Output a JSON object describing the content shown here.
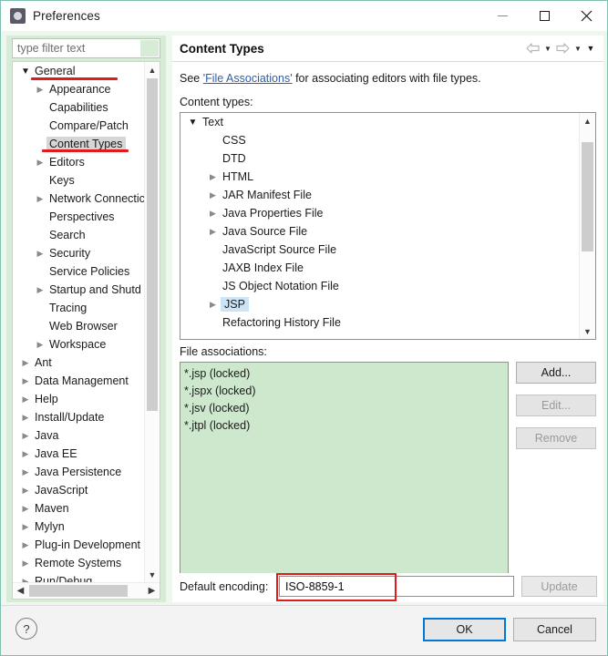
{
  "window": {
    "title": "Preferences",
    "icon": "preferences-gear-icon",
    "controls": {
      "minimize": "—",
      "maximize": "□",
      "close": "✕"
    }
  },
  "filter": {
    "placeholder": "type filter text",
    "value": ""
  },
  "sidebar": {
    "items": [
      {
        "label": "General",
        "indent": 0,
        "arrow": "down",
        "selected": false
      },
      {
        "label": "Appearance",
        "indent": 1,
        "arrow": "right",
        "selected": false
      },
      {
        "label": "Capabilities",
        "indent": 1,
        "arrow": "none",
        "selected": false
      },
      {
        "label": "Compare/Patch",
        "indent": 1,
        "arrow": "none",
        "selected": false
      },
      {
        "label": "Content Types",
        "indent": 1,
        "arrow": "none",
        "selected": true
      },
      {
        "label": "Editors",
        "indent": 1,
        "arrow": "right",
        "selected": false
      },
      {
        "label": "Keys",
        "indent": 1,
        "arrow": "none",
        "selected": false
      },
      {
        "label": "Network Connectic",
        "indent": 1,
        "arrow": "right",
        "selected": false
      },
      {
        "label": "Perspectives",
        "indent": 1,
        "arrow": "none",
        "selected": false
      },
      {
        "label": "Search",
        "indent": 1,
        "arrow": "none",
        "selected": false
      },
      {
        "label": "Security",
        "indent": 1,
        "arrow": "right",
        "selected": false
      },
      {
        "label": "Service Policies",
        "indent": 1,
        "arrow": "none",
        "selected": false
      },
      {
        "label": "Startup and Shutd",
        "indent": 1,
        "arrow": "right",
        "selected": false
      },
      {
        "label": "Tracing",
        "indent": 1,
        "arrow": "none",
        "selected": false
      },
      {
        "label": "Web Browser",
        "indent": 1,
        "arrow": "none",
        "selected": false
      },
      {
        "label": "Workspace",
        "indent": 1,
        "arrow": "right",
        "selected": false
      },
      {
        "label": "Ant",
        "indent": 0,
        "arrow": "right",
        "selected": false
      },
      {
        "label": "Data Management",
        "indent": 0,
        "arrow": "right",
        "selected": false
      },
      {
        "label": "Help",
        "indent": 0,
        "arrow": "right",
        "selected": false
      },
      {
        "label": "Install/Update",
        "indent": 0,
        "arrow": "right",
        "selected": false
      },
      {
        "label": "Java",
        "indent": 0,
        "arrow": "right",
        "selected": false
      },
      {
        "label": "Java EE",
        "indent": 0,
        "arrow": "right",
        "selected": false
      },
      {
        "label": "Java Persistence",
        "indent": 0,
        "arrow": "right",
        "selected": false
      },
      {
        "label": "JavaScript",
        "indent": 0,
        "arrow": "right",
        "selected": false
      },
      {
        "label": "Maven",
        "indent": 0,
        "arrow": "right",
        "selected": false
      },
      {
        "label": "Mylyn",
        "indent": 0,
        "arrow": "right",
        "selected": false
      },
      {
        "label": "Plug-in Development",
        "indent": 0,
        "arrow": "right",
        "selected": false
      },
      {
        "label": "Remote Systems",
        "indent": 0,
        "arrow": "right",
        "selected": false
      },
      {
        "label": "Run/Debug",
        "indent": 0,
        "arrow": "right",
        "selected": false
      }
    ]
  },
  "page": {
    "title": "Content Types",
    "toolbar": {
      "back_icon": "back-arrow-icon",
      "back_menu_icon": "chevron-down-icon",
      "forward_icon": "forward-arrow-icon",
      "forward_menu_icon": "chevron-down-icon",
      "menu_icon": "chevron-down-icon"
    },
    "description_prefix": "See ",
    "description_link": "'File Associations'",
    "description_suffix": " for associating editors with file types.",
    "content_types_label": "Content types:",
    "content_types": [
      {
        "label": "Text",
        "indent": 0,
        "arrow": "down",
        "selected": false
      },
      {
        "label": "CSS",
        "indent": 1,
        "arrow": "none",
        "selected": false
      },
      {
        "label": "DTD",
        "indent": 1,
        "arrow": "none",
        "selected": false
      },
      {
        "label": "HTML",
        "indent": 1,
        "arrow": "right",
        "selected": false
      },
      {
        "label": "JAR Manifest File",
        "indent": 1,
        "arrow": "right",
        "selected": false
      },
      {
        "label": "Java Properties File",
        "indent": 1,
        "arrow": "right",
        "selected": false
      },
      {
        "label": "Java Source File",
        "indent": 1,
        "arrow": "right",
        "selected": false
      },
      {
        "label": "JavaScript Source File",
        "indent": 1,
        "arrow": "none",
        "selected": false
      },
      {
        "label": "JAXB Index File",
        "indent": 1,
        "arrow": "none",
        "selected": false
      },
      {
        "label": "JS Object Notation File",
        "indent": 1,
        "arrow": "none",
        "selected": false
      },
      {
        "label": "JSP",
        "indent": 1,
        "arrow": "right",
        "selected": true
      },
      {
        "label": "Refactoring History File",
        "indent": 1,
        "arrow": "none",
        "selected": false
      }
    ],
    "file_associations_label": "File associations:",
    "file_associations": [
      "*.jsp (locked)",
      "*.jspx (locked)",
      "*.jsv (locked)",
      "*.jtpl (locked)"
    ],
    "buttons": {
      "add": "Add...",
      "edit": "Edit...",
      "remove": "Remove"
    },
    "encoding_label": "Default encoding:",
    "encoding_value": "ISO-8859-1",
    "update_label": "Update"
  },
  "footer": {
    "help_icon": "question-mark-icon",
    "ok": "OK",
    "cancel": "Cancel"
  },
  "colors": {
    "annotation_red": "#e01b1b",
    "selection_blue": "#cde4f7",
    "list_green": "#cde8cd",
    "panel_green": "#d7ecd7",
    "focus_blue": "#0078d7"
  }
}
